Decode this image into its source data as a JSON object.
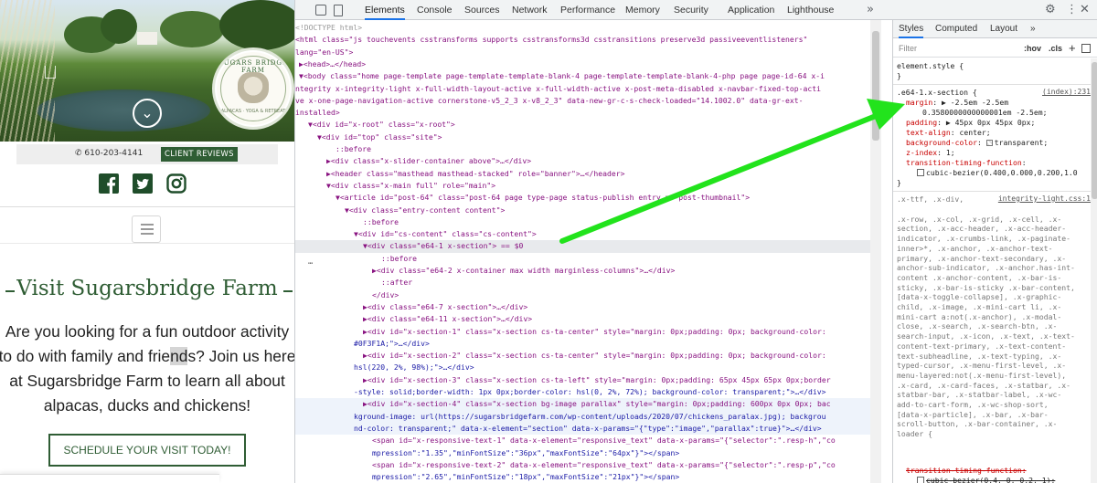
{
  "site": {
    "logo": {
      "title": "SUGARS BRIDGE FARM",
      "subtitle": "ALPACAS · YOGA & RETREAT"
    },
    "phone": "610-203-4141",
    "reviews_button": "CLIENT REVIEWS",
    "social": [
      "facebook-icon",
      "twitter-icon",
      "instagram-icon"
    ],
    "heading": "Visit Sugarsbridge Farm",
    "intro": {
      "line1": "Are you looking for a fun outdoor activity",
      "line2a": "to do with family and frie",
      "line2b": "nd",
      "line2c": "s? Join us here",
      "line3": "at Sugarsbridge Farm to learn all about",
      "line4": "alpacas, ducks and chickens!"
    },
    "cta": "SCHEDULE YOUR VISIT TODAY!"
  },
  "devtools": {
    "tabs": [
      "Elements",
      "Console",
      "Sources",
      "Network",
      "Performance",
      "Memory",
      "Security",
      "Application",
      "Lighthouse"
    ],
    "active_tab": "Elements",
    "more": "»",
    "elements": {
      "l1": "<!DOCTYPE html>",
      "l2": "<html class=\"js touchevents csstransforms supports csstransforms3d csstransitions preserve3d passiveeventlisteners\"",
      "l3": "lang=\"en-US\">",
      "l4": "▶<head>…</head>",
      "l5": "▼<body class=\"home page-template page-template-template-blank-4 page-template-template-blank-4-php page page-id-64 x-i",
      "l6": "ntegrity x-integrity-light x-full-width-layout-active x-full-width-active x-post-meta-disabled x-navbar-fixed-top-acti",
      "l7": "ve x-one-page-navigation-active cornerstone-v5_2_3 x-v8_2_3\" data-new-gr-c-s-check-loaded=\"14.1002.0\" data-gr-ext-",
      "l8": "installed>",
      "l9": "▼<div id=\"x-root\" class=\"x-root\">",
      "l10": "▼<div id=\"top\" class=\"site\">",
      "l11": "::before",
      "l12": "▶<div class=\"x-slider-container above\">…</div>",
      "l13": "▶<header class=\"masthead masthead-stacked\" role=\"banner\">…</header>",
      "l14": "▼<div class=\"x-main full\" role=\"main\">",
      "l15": "▼<article id=\"post-64\" class=\"post-64 page type-page status-publish entry no-post-thumbnail\">",
      "l16": "▼<div class=\"entry-content content\">",
      "l17": "::before",
      "l18": "▼<div id=\"cs-content\" class=\"cs-content\">",
      "l19": "▼<div class=\"e64-1 x-section\"> == $0",
      "l20": "::before",
      "l21": "▶<div class=\"e64-2 x-container max width marginless-columns\">…</div>",
      "l22": "::after",
      "l23": "</div>",
      "l24": "▶<div class=\"e64-7 x-section\">…</div>",
      "l25": "▶<div class=\"e64-11 x-section\">…</div>",
      "l26": "▶<div id=\"x-section-1\" class=\"x-section cs-ta-center\" style=\"margin: 0px;padding: 0px; background-color:",
      "l27": "#0F3F1A;\">…</div>",
      "l28": "▶<div id=\"x-section-2\" class=\"x-section cs-ta-center\" style=\"margin: 0px;padding: 0px; background-color:",
      "l29": "hsl(220, 2%, 98%);\">…</div>",
      "l30": "▶<div id=\"x-section-3\" class=\"x-section cs-ta-left\" style=\"margin: 0px;padding: 65px 45px 65px 0px;border",
      "l31": "-style: solid;border-width: 1px 0px;border-color: hsl(0, 2%, 72%); background-color: transparent;\">…</div>",
      "l32": "▶<div id=\"x-section-4\" class=\"x-section bg-image parallax\" style=\"margin: 0px;padding: 600px 0px 0px; bac",
      "l33": "kground-image: url(https://sugarsbridgefarm.com/wp-content/uploads/2020/07/chickens_paralax.jpg); backgrou",
      "l34": "nd-color: transparent;\" data-x-element=\"section\" data-x-params=\"{\"type\":\"image\",\"parallax\":true}\">…</div>",
      "l35": "<span id=\"x-responsive-text-1\" data-x-element=\"responsive_text\" data-x-params=\"{\"selector\":\".resp-h\",\"co",
      "l36": "mpression\":\"1.35\",\"minFontSize\":\"36px\",\"maxFontSize\":\"64px\"}\"></span>",
      "l37": "<span id=\"x-responsive-text-2\" data-x-element=\"responsive_text\" data-x-params=\"{\"selector\":\".resp-p\",\"co",
      "l38": "mpression\":\"2.65\",\"minFontSize\":\"18px\",\"maxFontSize\":\"21px\"}\"></span>"
    },
    "styles": {
      "tabs": [
        "Styles",
        "Computed",
        "Layout",
        "»"
      ],
      "filter_placeholder": "Filter",
      "hov": ":hov",
      "cls": ".cls",
      "element_style": "element.style {",
      "rule1_selector": ".e64-1.x-section {",
      "rule1_source": "(index):231",
      "rule1_props": [
        {
          "name": "margin",
          "value": "▶ -2.5em -2.5em"
        },
        {
          "name": "",
          "value": "0.3580000000000001em -2.5em;"
        },
        {
          "name": "padding",
          "value": "▶ 45px 0px 45px 0px;"
        },
        {
          "name": "text-align",
          "value": "center;"
        },
        {
          "name": "background-color",
          "value": "transparent;"
        },
        {
          "name": "z-index",
          "value": "1;"
        },
        {
          "name": "transition-timing-function",
          "value": ""
        },
        {
          "name": "",
          "value": "cubic-bezier(0.400,0.000,0.200,1.0"
        }
      ],
      "rule2_source": "integrity-light.css:1",
      "rule2_selector_lines": [
        ".x-ttf, .x-div,",
        ".x-row, .x-col, .x-grid, .x-cell, .x-",
        "section, .x-acc-header, .x-acc-header-",
        "indicator, .x-crumbs-link, .x-paginate-",
        "inner>*, .x-anchor, .x-anchor-text-",
        "primary, .x-anchor-text-secondary, .x-",
        "anchor-sub-indicator, .x-anchor.has-int-",
        "content .x-anchor-content, .x-bar-is-",
        "sticky, .x-bar-is-sticky .x-bar-content,",
        "[data-x-toggle-collapse], .x-graphic-",
        "child, .x-image, .x-mini-cart li, .x-",
        "mini-cart a:not(.x-anchor), .x-modal-",
        "close, .x-search, .x-search-btn, .x-",
        "search-input, .x-icon, .x-text, .x-text-",
        "content-text-primary, .x-text-content-",
        "text-subheadline, .x-text-typing, .x-",
        "typed-cursor, .x-menu-first-level, .x-",
        "menu-layered:not(.x-menu-first-level),",
        ".x-card, .x-card-faces, .x-statbar, .x-",
        "statbar-bar, .x-statbar-label, .x-wc-",
        "add-to-cart-form, .x-wc-shop-sort,",
        "[data-x-particle], .x-bar, .x-bar-",
        "scroll-button, .x-bar-container, .x-",
        "loader {"
      ],
      "rule2_prop1": "transition-timing-function:",
      "rule2_prop2": "cubic-bezier(0.4, 0, 0.2, 1);"
    }
  }
}
